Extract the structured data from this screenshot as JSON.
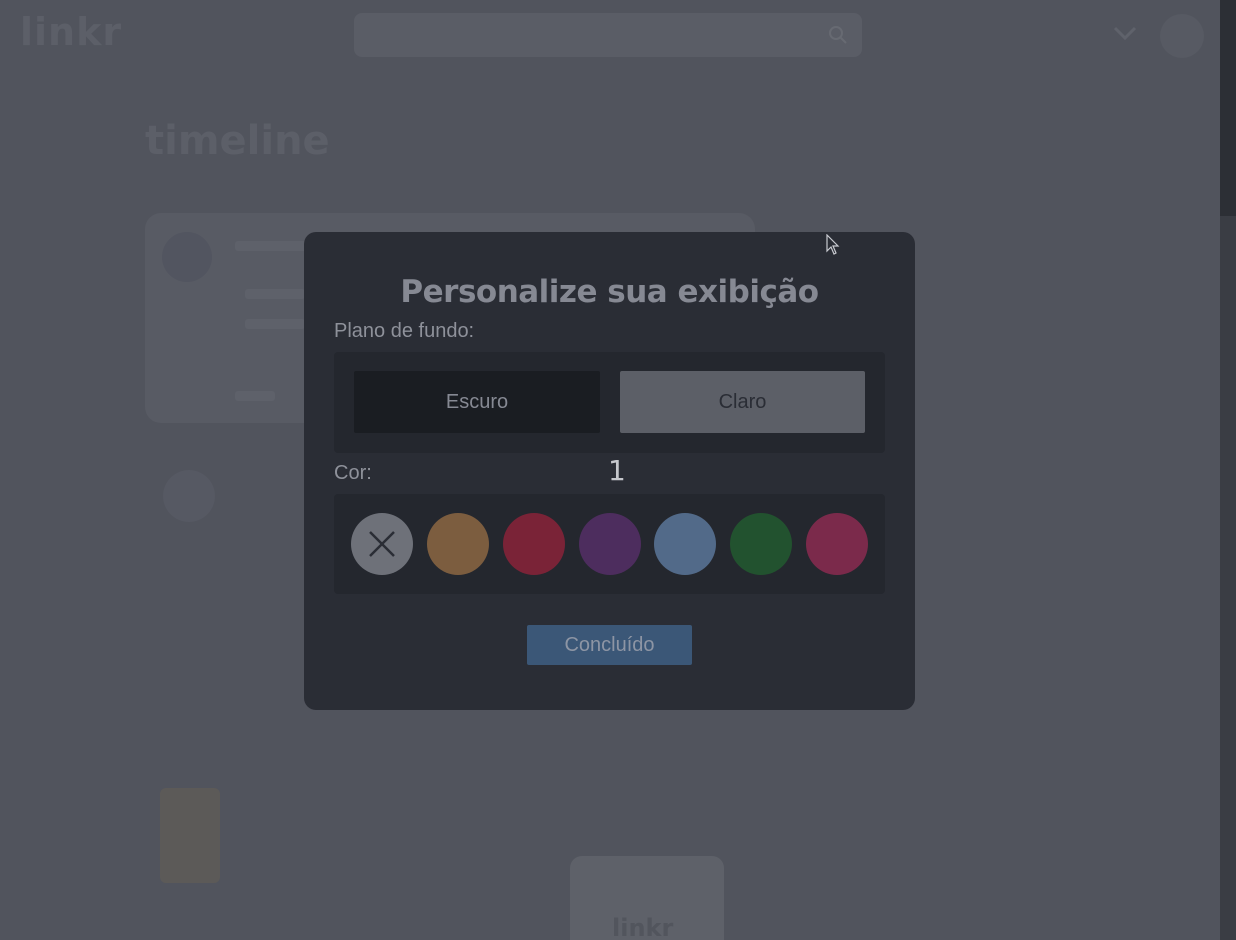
{
  "header": {
    "logo": "linkr",
    "search_placeholder": "",
    "icons": {
      "search": "search-icon",
      "menu": "chevron-down-icon"
    }
  },
  "page": {
    "title": "timeline"
  },
  "feed": {
    "items": [
      {
        "name": ""
      },
      {
        "name": "",
        "text": ""
      }
    ],
    "preview_logo": "linkr"
  },
  "modal": {
    "title": "Personalize sua exibição",
    "background_label": "Plano de fundo:",
    "background_options": [
      "Escuro",
      "Claro"
    ],
    "color_label": "Cor:",
    "badge": "1",
    "colors": [
      {
        "name": "none",
        "hex": "#6e7179"
      },
      {
        "name": "orange",
        "hex": "#7c5d3f"
      },
      {
        "name": "red",
        "hex": "#7a2337"
      },
      {
        "name": "purple",
        "hex": "#4d2d5e"
      },
      {
        "name": "blue",
        "hex": "#526a89"
      },
      {
        "name": "green",
        "hex": "#22522f"
      },
      {
        "name": "pink",
        "hex": "#7b2a4b"
      }
    ],
    "done_label": "Concluído"
  }
}
